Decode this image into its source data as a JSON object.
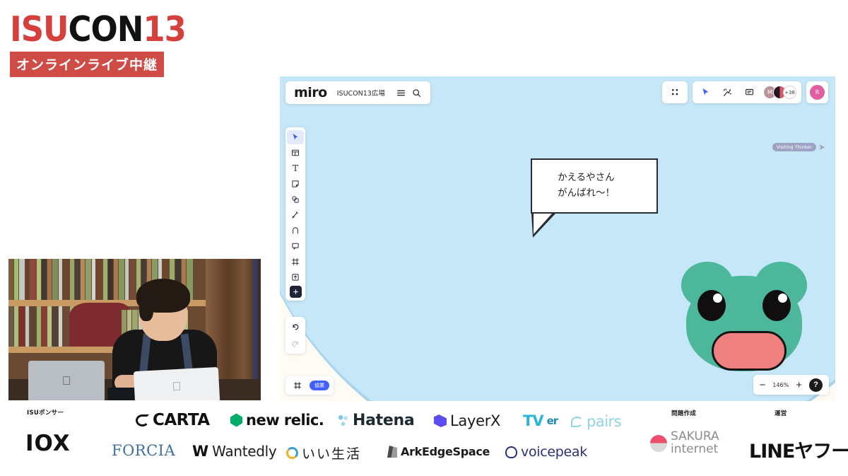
{
  "logo": {
    "isu": "ISU",
    "con": "CON",
    "thirteen": "13",
    "banner": "オンラインライブ中継"
  },
  "webcam": {
    "label": "live-camera-feed"
  },
  "miro": {
    "brand": "miro",
    "board_name": "ISUCON13広場",
    "menu_icon": "hamburger-menu-icon",
    "search_icon": "search-icon",
    "toolbar_right": {
      "apps_icon": "apps-grid-icon",
      "cursor_icon": "cursor-pointer-icon",
      "reactions_icon": "reactions-icon",
      "comment_icon": "comment-icon"
    },
    "avatars": [
      {
        "initial": "M",
        "color": "#b9959a"
      },
      {
        "initial": "",
        "color": "#2a1f2b"
      },
      {
        "initial": "+38",
        "color": "#ffffff"
      }
    ],
    "solo_avatar": {
      "initial": "R",
      "color": "#e05fa0"
    },
    "left_tools": [
      {
        "name": "select-tool",
        "glyph": "cursor",
        "active": true
      },
      {
        "name": "templates-tool",
        "glyph": "template",
        "active": false
      },
      {
        "name": "text-tool",
        "glyph": "T",
        "active": false
      },
      {
        "name": "sticky-note-tool",
        "glyph": "sticky",
        "active": false
      },
      {
        "name": "shapes-tool",
        "glyph": "shapes",
        "active": false
      },
      {
        "name": "pen-tool",
        "glyph": "pen",
        "active": false
      },
      {
        "name": "connector-tool",
        "glyph": "connector",
        "active": false
      },
      {
        "name": "comment-tool",
        "glyph": "comment",
        "active": false
      },
      {
        "name": "frame-tool",
        "glyph": "frame",
        "active": false
      },
      {
        "name": "upload-tool",
        "glyph": "upload",
        "active": false
      },
      {
        "name": "more-apps-tool",
        "glyph": "plus",
        "active": false
      }
    ],
    "undo_label": "undo",
    "redo_label": "redo",
    "frame_chip": "協業",
    "zoom_level": "146%",
    "zoom_out": "−",
    "zoom_in": "+",
    "help": "?",
    "collaborator": {
      "name": "Visiting Thinker"
    },
    "bubble_text": "かえるやさん\nがんばれ〜！",
    "canvas": {
      "blob_color": "#bfe4f5",
      "background_color": "#fdfbf4",
      "frog_body_color": "#4cb79a",
      "frog_mouth_color": "#ef8080"
    }
  },
  "sponsors": {
    "label_isuponsor": "ISUポンサー",
    "label_problem": "問題作成",
    "label_operator": "運営",
    "row1": [
      {
        "name": "carta",
        "text": "CARTA"
      },
      {
        "name": "new-relic",
        "text": "new relic."
      },
      {
        "name": "hatena",
        "text": "Hatena"
      },
      {
        "name": "layerx",
        "text": "LayerX"
      },
      {
        "name": "tver",
        "text": "TV",
        "text2": "er"
      },
      {
        "name": "pairs",
        "text": "pairs"
      }
    ],
    "row2": [
      {
        "name": "10x",
        "text": "IOX"
      },
      {
        "name": "forcia",
        "text": "FORCIA"
      },
      {
        "name": "wantedly",
        "text": "Wantedly"
      },
      {
        "name": "ii-seikatsu",
        "text": "いい生活"
      },
      {
        "name": "ark-edge-space",
        "text": "ArkEdgeSpace"
      },
      {
        "name": "voicepeak",
        "text": "voicepeak"
      }
    ],
    "sakura": {
      "line1": "SAKURA",
      "line2": "internet"
    },
    "lineyahoo": "LINEヤフー"
  }
}
